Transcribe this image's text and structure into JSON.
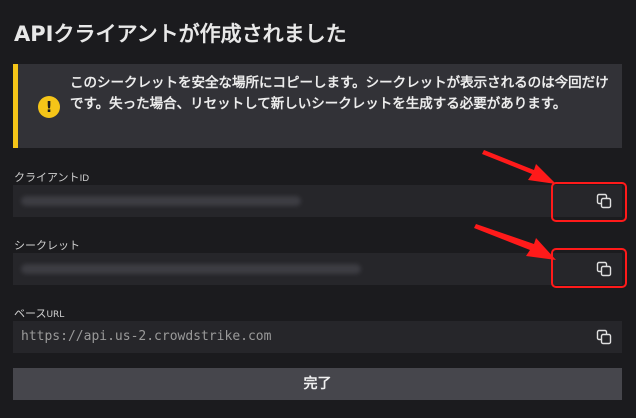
{
  "dialog": {
    "title": "APIクライアントが作成されました",
    "alert": {
      "icon": "exclamation-icon",
      "text": "このシークレットを安全な場所にコピーします。シークレットが表示されるのは今回だけです。失った場合、リセットして新しいシークレットを生成する必要があります。"
    },
    "fields": [
      {
        "label": "クライアント",
        "label_small": "ID",
        "value": "",
        "blurred": true,
        "icon": "copy-icon"
      },
      {
        "label": "シークレット",
        "label_small": "",
        "value": "",
        "blurred": true,
        "icon": "copy-icon"
      },
      {
        "label": "ベース",
        "label_small": "URL",
        "value": "https://api.us-2.crowdstrike.com",
        "blurred": false,
        "icon": "copy-icon"
      }
    ],
    "done_label": "完了"
  },
  "colors": {
    "background": "#1b1b1e",
    "alert_bg": "#323237",
    "warning": "#f5c518",
    "field_bg": "#26262a",
    "button_bg": "#46464c",
    "annotation_red": "#ff1a1a"
  }
}
